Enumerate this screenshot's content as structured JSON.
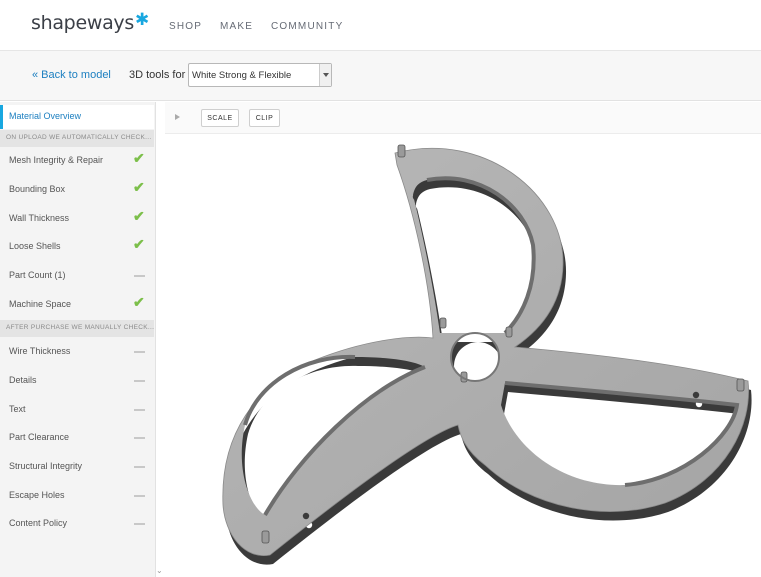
{
  "header": {
    "logo": "shapeways",
    "nav": [
      "SHOP",
      "MAKE",
      "COMMUNITY"
    ]
  },
  "toolbar": {
    "back_label": "« Back to model",
    "tools_label": "3D tools for",
    "material_selected": "White Strong & Flexible"
  },
  "sidebar": {
    "active": "Material Overview",
    "auto_header": "ON UPLOAD WE AUTOMATICALLY CHECK...",
    "auto_items": [
      {
        "label": "Mesh Integrity & Repair",
        "status": "pass"
      },
      {
        "label": "Bounding Box",
        "status": "pass"
      },
      {
        "label": "Wall Thickness",
        "status": "pass"
      },
      {
        "label": "Loose Shells",
        "status": "pass"
      },
      {
        "label": "Part Count (1)",
        "status": "neutral"
      },
      {
        "label": "Machine Space",
        "status": "pass"
      }
    ],
    "manual_header": "AFTER PURCHASE WE MANUALLY CHECK...",
    "manual_items": [
      {
        "label": "Wire Thickness",
        "status": "neutral"
      },
      {
        "label": "Details",
        "status": "neutral"
      },
      {
        "label": "Text",
        "status": "neutral"
      },
      {
        "label": "Part Clearance",
        "status": "neutral"
      },
      {
        "label": "Structural Integrity",
        "status": "neutral"
      },
      {
        "label": "Escape Holes",
        "status": "neutral"
      },
      {
        "label": "Content Policy",
        "status": "neutral"
      }
    ]
  },
  "viewer": {
    "scale_label": "SCALE",
    "clip_label": "CLIP"
  },
  "icons": {
    "pass": "check-icon",
    "neutral": "dash-icon",
    "accent": "#18a7e0",
    "check_color": "#7cbf4a"
  }
}
